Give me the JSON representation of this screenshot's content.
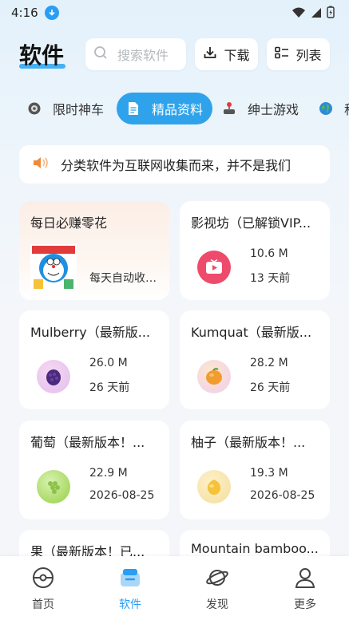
{
  "status_bar": {
    "time": "4:16"
  },
  "header": {
    "title": "软件",
    "search_placeholder": "搜索软件",
    "download_label": "下载",
    "list_label": "列表"
  },
  "tabs": [
    {
      "label": "限时神车",
      "icon": "gear-icon"
    },
    {
      "label": "精品资料",
      "icon": "document-icon",
      "active": true
    },
    {
      "label": "绅士游戏",
      "icon": "joystick-icon"
    },
    {
      "label": "科",
      "icon": "globe-icon"
    }
  ],
  "notice": {
    "text": "分类软件为互联网收集而来，并不是我们",
    "icon": "speaker-icon"
  },
  "cards": [
    {
      "title": "每日必赚零花",
      "desc": "每天自动收益...",
      "icon": "doraemon-image"
    },
    {
      "title": "影视坊（已解锁VIP...",
      "size": "10.6 M",
      "date": "13 天前",
      "icon": "tv-play-icon",
      "color": "#ee4a6b"
    },
    {
      "title": "Mulberry（最新版...",
      "size": "26.0 M",
      "date": "26 天前",
      "icon": "mulberry-icon",
      "color": "#6c3fa6"
    },
    {
      "title": "Kumquat（最新版...",
      "size": "28.2 M",
      "date": "26 天前",
      "icon": "kumquat-icon",
      "color": "#f29b2e"
    },
    {
      "title": "葡萄（最新版本！...",
      "size": "22.9 M",
      "date": "2026-08-25",
      "icon": "grape-icon",
      "color": "#a3d65a"
    },
    {
      "title": "柚子（最新版本！...",
      "size": "19.3 M",
      "date": "2026-08-25",
      "icon": "pomelo-icon",
      "color": "#f5c23a"
    },
    {
      "title": "果（最新版本！已...",
      "icon": "fruit-icon"
    },
    {
      "title": "Mountain bamboo...",
      "icon": "bamboo-icon"
    }
  ],
  "bottom_nav": [
    {
      "label": "首页",
      "icon": "home-icon"
    },
    {
      "label": "软件",
      "icon": "software-icon",
      "active": true
    },
    {
      "label": "发现",
      "icon": "discover-icon"
    },
    {
      "label": "更多",
      "icon": "profile-icon"
    }
  ],
  "colors": {
    "accent": "#2ea3ec"
  }
}
